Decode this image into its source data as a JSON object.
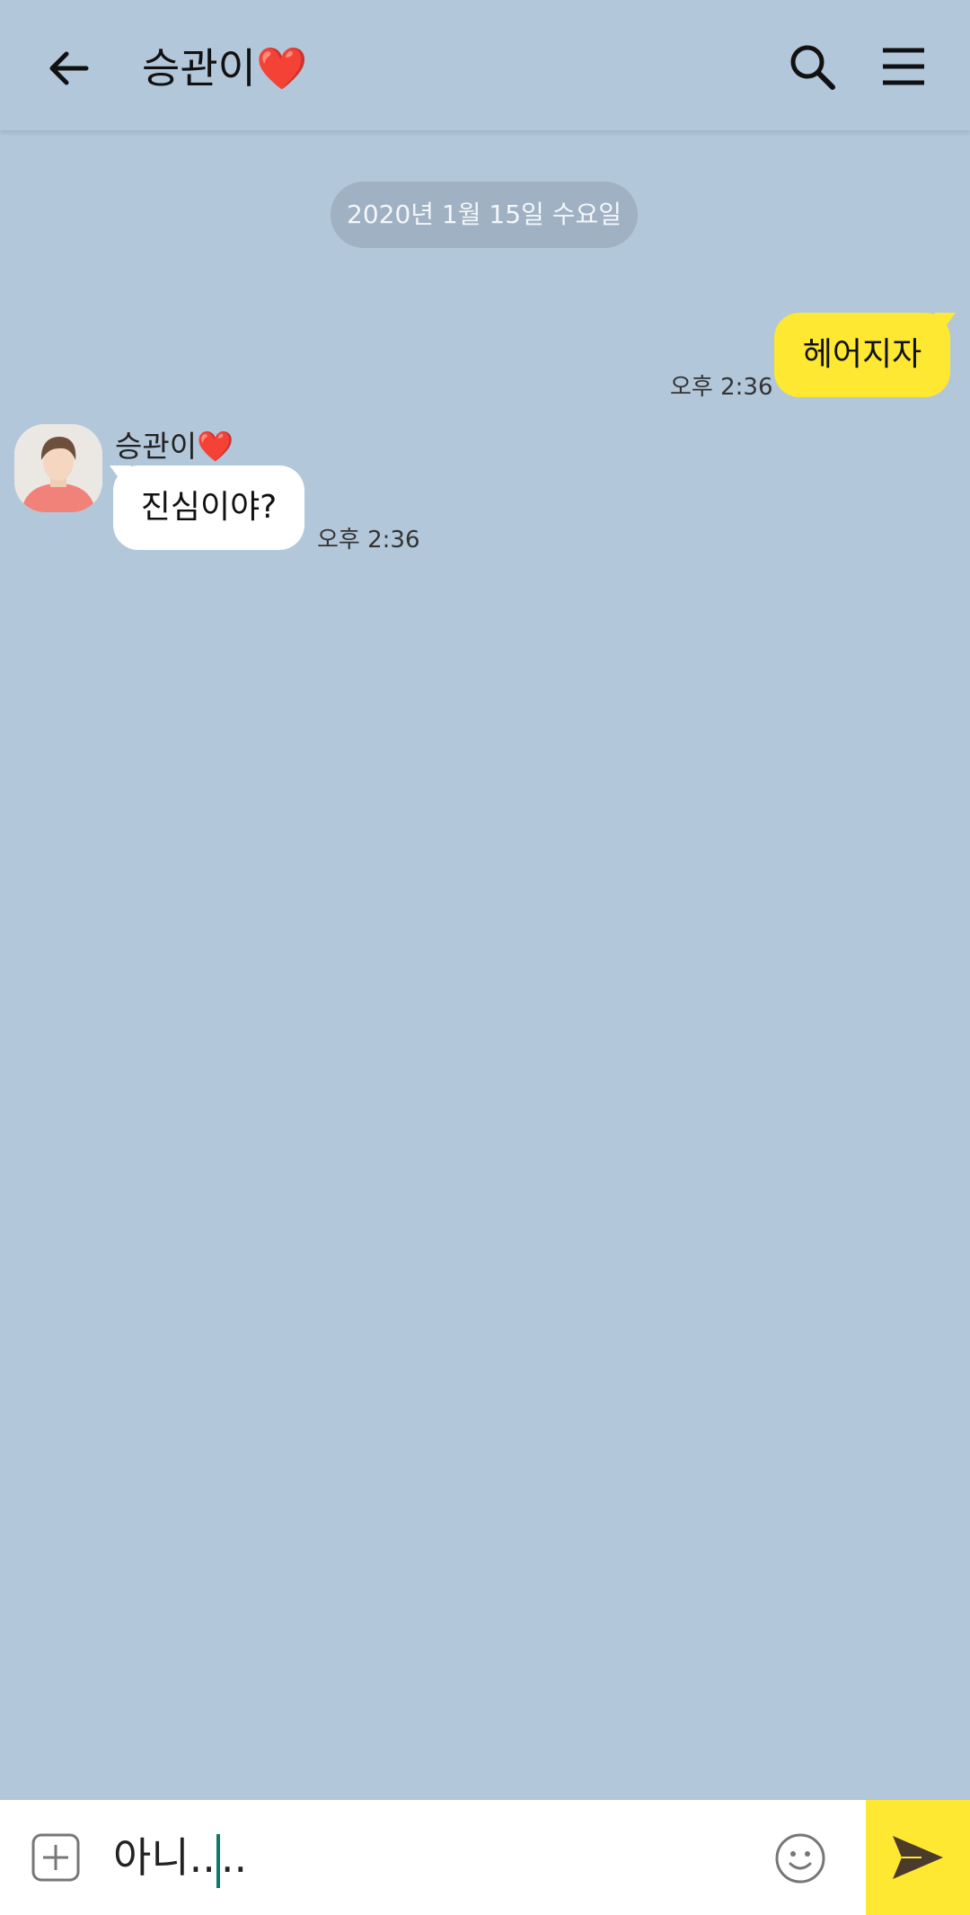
{
  "header": {
    "title": "승관이❤️"
  },
  "chat": {
    "date_label": "2020년 1월 15일 수요일",
    "messages": [
      {
        "from": "me",
        "text": "헤어지자",
        "time": "오후 2:36"
      },
      {
        "from": "other",
        "sender": "승관이❤️",
        "text": "진심이야?",
        "time": "오후 2:36"
      }
    ]
  },
  "input": {
    "text_before_cursor": "아니..",
    "text_after_cursor": ".."
  },
  "colors": {
    "background": "#b2c7da",
    "my_bubble": "#fee832",
    "other_bubble": "#ffffff",
    "send_button": "#fee832"
  },
  "icons": {
    "back": "arrow-left-icon",
    "search": "search-icon",
    "menu": "hamburger-menu-icon",
    "attach": "plus-square-icon",
    "emoji": "smiley-icon",
    "send": "paper-plane-icon"
  }
}
